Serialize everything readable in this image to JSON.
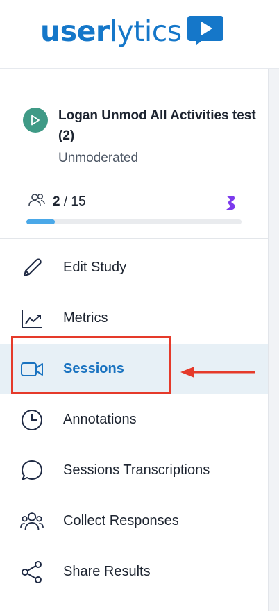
{
  "header": {
    "logo_text_bold": "user",
    "logo_text_light": "lytics",
    "logo_badge_icon": "play-speech-icon",
    "brand_color": "#1577c9"
  },
  "study": {
    "status_icon": "play-icon",
    "status_color": "#3f9a86",
    "title": "Logan Unmod All Activities test (2)",
    "type": "Unmoderated",
    "participants_icon": "users-icon",
    "participants_done": "2",
    "participants_separator": "/ 15",
    "progress_fraction": 0.1333,
    "badge_icon": "b-badge-icon",
    "badge_color": "#7c3aed"
  },
  "nav": {
    "items": [
      {
        "label": "Edit Study",
        "icon": "pencil-icon",
        "active": false
      },
      {
        "label": "Metrics",
        "icon": "chart-icon",
        "active": false
      },
      {
        "label": "Sessions",
        "icon": "video-camera-icon",
        "active": true
      },
      {
        "label": "Annotations",
        "icon": "clock-icon",
        "active": false
      },
      {
        "label": "Sessions Transcriptions",
        "icon": "chat-bubble-icon",
        "active": false
      },
      {
        "label": "Collect Responses",
        "icon": "users-icon",
        "active": false
      },
      {
        "label": "Share Results",
        "icon": "share-icon",
        "active": false
      }
    ],
    "active_color": "#1a73c0",
    "active_bg": "#e7f0f6"
  },
  "annotation": {
    "highlight_color": "#e53a2a"
  }
}
